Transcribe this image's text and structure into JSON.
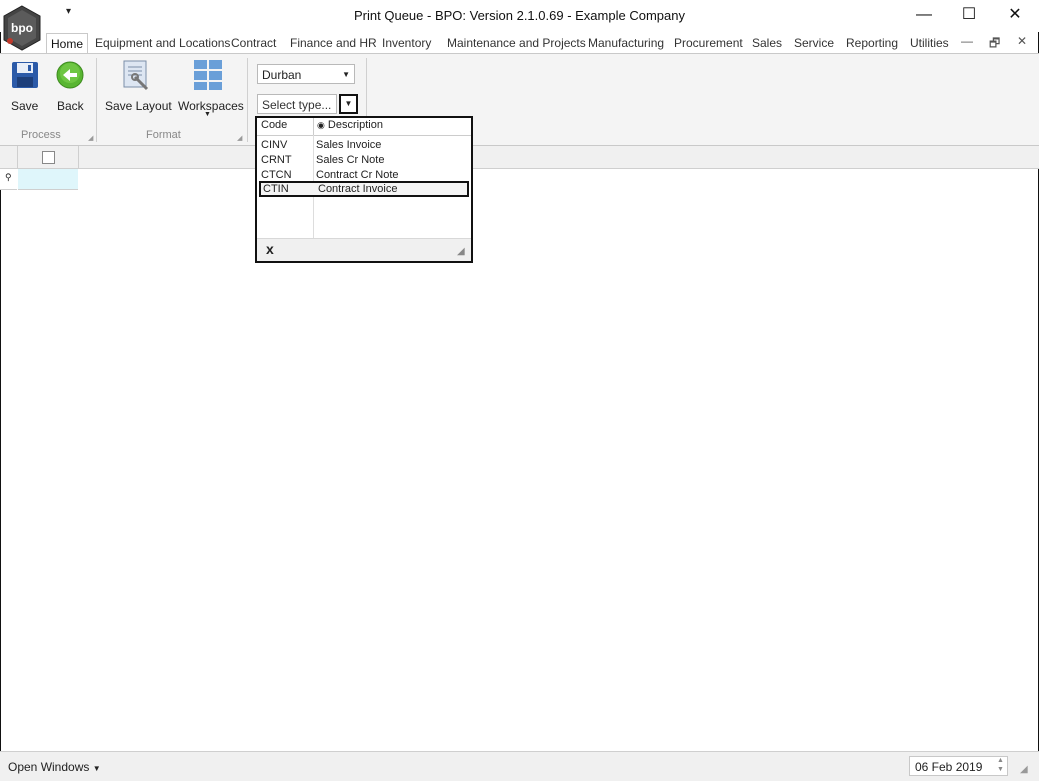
{
  "window": {
    "title": "Print Queue - BPO: Version 2.1.0.69 - Example Company",
    "minimize": "—",
    "maximize": "☐",
    "close": "✕",
    "qat_arrow": "▾"
  },
  "tabs": [
    {
      "label": "Home",
      "active": true
    },
    {
      "label": "Equipment and Locations"
    },
    {
      "label": "Contract"
    },
    {
      "label": "Finance and HR"
    },
    {
      "label": "Inventory"
    },
    {
      "label": "Maintenance and Projects"
    },
    {
      "label": "Manufacturing"
    },
    {
      "label": "Procurement"
    },
    {
      "label": "Sales"
    },
    {
      "label": "Service"
    },
    {
      "label": "Reporting"
    },
    {
      "label": "Utilities"
    }
  ],
  "mdi_controls": {
    "minimize": "—",
    "restore": "🗗",
    "close": "✕"
  },
  "ribbon": {
    "process": {
      "label": "Process",
      "save": "Save",
      "back": "Back"
    },
    "format": {
      "label": "Format",
      "save_layout": "Save Layout",
      "workspaces": "Workspaces"
    },
    "location_combo": "Durban",
    "type_combo_placeholder": "Select type..."
  },
  "popup": {
    "columns": {
      "code": "Code",
      "description": "Description"
    },
    "rows": [
      {
        "code": "CINV",
        "description": "Sales Invoice"
      },
      {
        "code": "CRNT",
        "description": "Sales Cr Note"
      },
      {
        "code": "CTCN",
        "description": "Contract Cr Note"
      },
      {
        "code": "CTIN",
        "description": "Contract Invoice",
        "selected": true
      }
    ],
    "close": "x"
  },
  "statusbar": {
    "open_windows": "Open Windows",
    "date": "06 Feb 2019"
  },
  "colors": {
    "ribbon_bg": "#f4f4f4",
    "save_icon": "#2b5aa8",
    "back_icon": "#58b531",
    "workspaces_icon": "#6a9fd8",
    "filter_row": "#dff6fb"
  }
}
